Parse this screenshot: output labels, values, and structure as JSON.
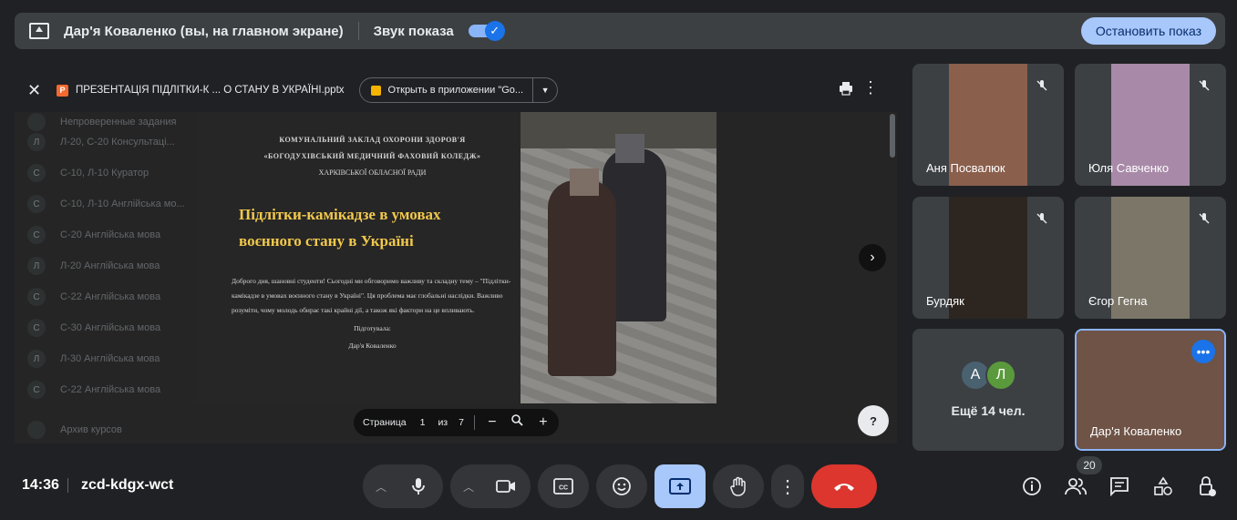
{
  "topbar": {
    "presenter_text": "Дар'я Коваленко (вы, на главном экране)",
    "sound_label": "Звук показа",
    "stop_label": "Остановить показ"
  },
  "viewer": {
    "file_name": "ПРЕЗЕНТАЦІЯ ПІДЛІТКИ-К ... О СТАНУ В УКРАЇНІ.pptx",
    "open_label": "Открыть в приложении \"Go...",
    "background_rows": [
      {
        "letter": "",
        "text": "Непроверенные задания"
      },
      {
        "letter": "Л",
        "text": "Л-20, С-20 Консультаці..."
      },
      {
        "letter": "С",
        "text": "С-10, Л-10 Куратор"
      },
      {
        "letter": "С",
        "text": "С-10, Л-10 Англійська мо..."
      },
      {
        "letter": "С",
        "text": "С-20 Англійська мова"
      },
      {
        "letter": "Л",
        "text": "Л-20 Англійська мова"
      },
      {
        "letter": "С",
        "text": "С-22 Англійська мова"
      },
      {
        "letter": "С",
        "text": "С-30 Англійська мова"
      },
      {
        "letter": "Л",
        "text": "Л-30 Англійська мова"
      },
      {
        "letter": "С",
        "text": "С-22 Англійська мова"
      },
      {
        "letter": "",
        "text": "Архив курсов"
      }
    ]
  },
  "slide": {
    "header_lines": [
      "КОМУНАЛЬНИЙ ЗАКЛАД ОХОРОНИ ЗДОРОВ'Я",
      "«БОГОДУХІВСЬКИЙ МЕДИЧНИЙ ФАХОВИЙ КОЛЕДЖ»",
      "ХАРКІВСЬКОЇ ОБЛАСНОЇ РАДИ"
    ],
    "title_line1": "Підлітки-камікадзе в умовах",
    "title_line2": "воєнного стану в Україні",
    "body": "Доброго дня, шановні студенти! Сьогодні ми обговоримо важливу та складну тему – \"Підлітки-камікадзе в умовах воєнного стану в Україні\". Ця проблема має глобальні наслідки. Важливо розуміти, чому молодь обирає такі крайні дії, а також які фактори на це впливають.",
    "prepared_label": "Підготувала:",
    "prepared_name": "Дар'я Коваленко"
  },
  "pager": {
    "page_label": "Страница",
    "page": "1",
    "of_label": "из",
    "total": "7"
  },
  "participants": [
    {
      "name": "Аня Посвалюк",
      "muted": true
    },
    {
      "name": "Юля Савченко",
      "muted": true
    },
    {
      "name": "Бурдяк",
      "muted": true
    },
    {
      "name": "Єгор Гегна",
      "muted": true
    }
  ],
  "others": {
    "avatars": [
      {
        "letter": "А",
        "color": "#4a6170"
      },
      {
        "letter": "Л",
        "color": "#5a9a3c"
      }
    ],
    "label": "Ещё 14 чел."
  },
  "self_tile": {
    "name": "Дар'я Коваленко"
  },
  "bottom": {
    "time": "14:36",
    "meeting_code": "zcd-kdgx-wct",
    "participants_count": "20"
  },
  "colors": {
    "accent": "#8ab4f8",
    "stop_button_bg": "#a8c7fa",
    "end_call": "#dc362e",
    "title_gold": "#f2c94c"
  }
}
